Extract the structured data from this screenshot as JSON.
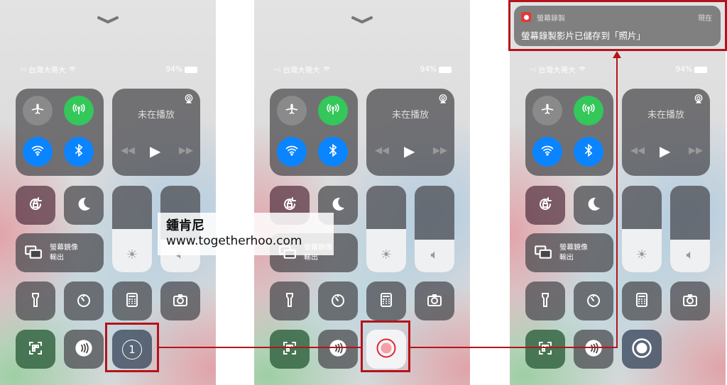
{
  "control_center": {
    "carrier": "台灣大哥大",
    "battery": "94%",
    "media_title": "未在播放",
    "mirroring_label_line1": "螢幕鏡像",
    "mirroring_label_line2": "輸出",
    "brightness_level": 0.5,
    "volume_level": 0.38
  },
  "panels": [
    {
      "record_state": "countdown",
      "countdown": "1",
      "show_chevron": true
    },
    {
      "record_state": "pressed",
      "show_chevron": true
    },
    {
      "record_state": "recording",
      "show_chevron": false
    }
  ],
  "notification": {
    "app": "螢幕錄製",
    "time": "現在",
    "message": "螢幕錄製影片已儲存到「照片」"
  },
  "watermark": {
    "name": "鍾肯尼",
    "url": "www.togetherhoo.com"
  },
  "colors": {
    "accent_red": "#b3141c",
    "green": "#34c759",
    "blue": "#0a84ff"
  }
}
